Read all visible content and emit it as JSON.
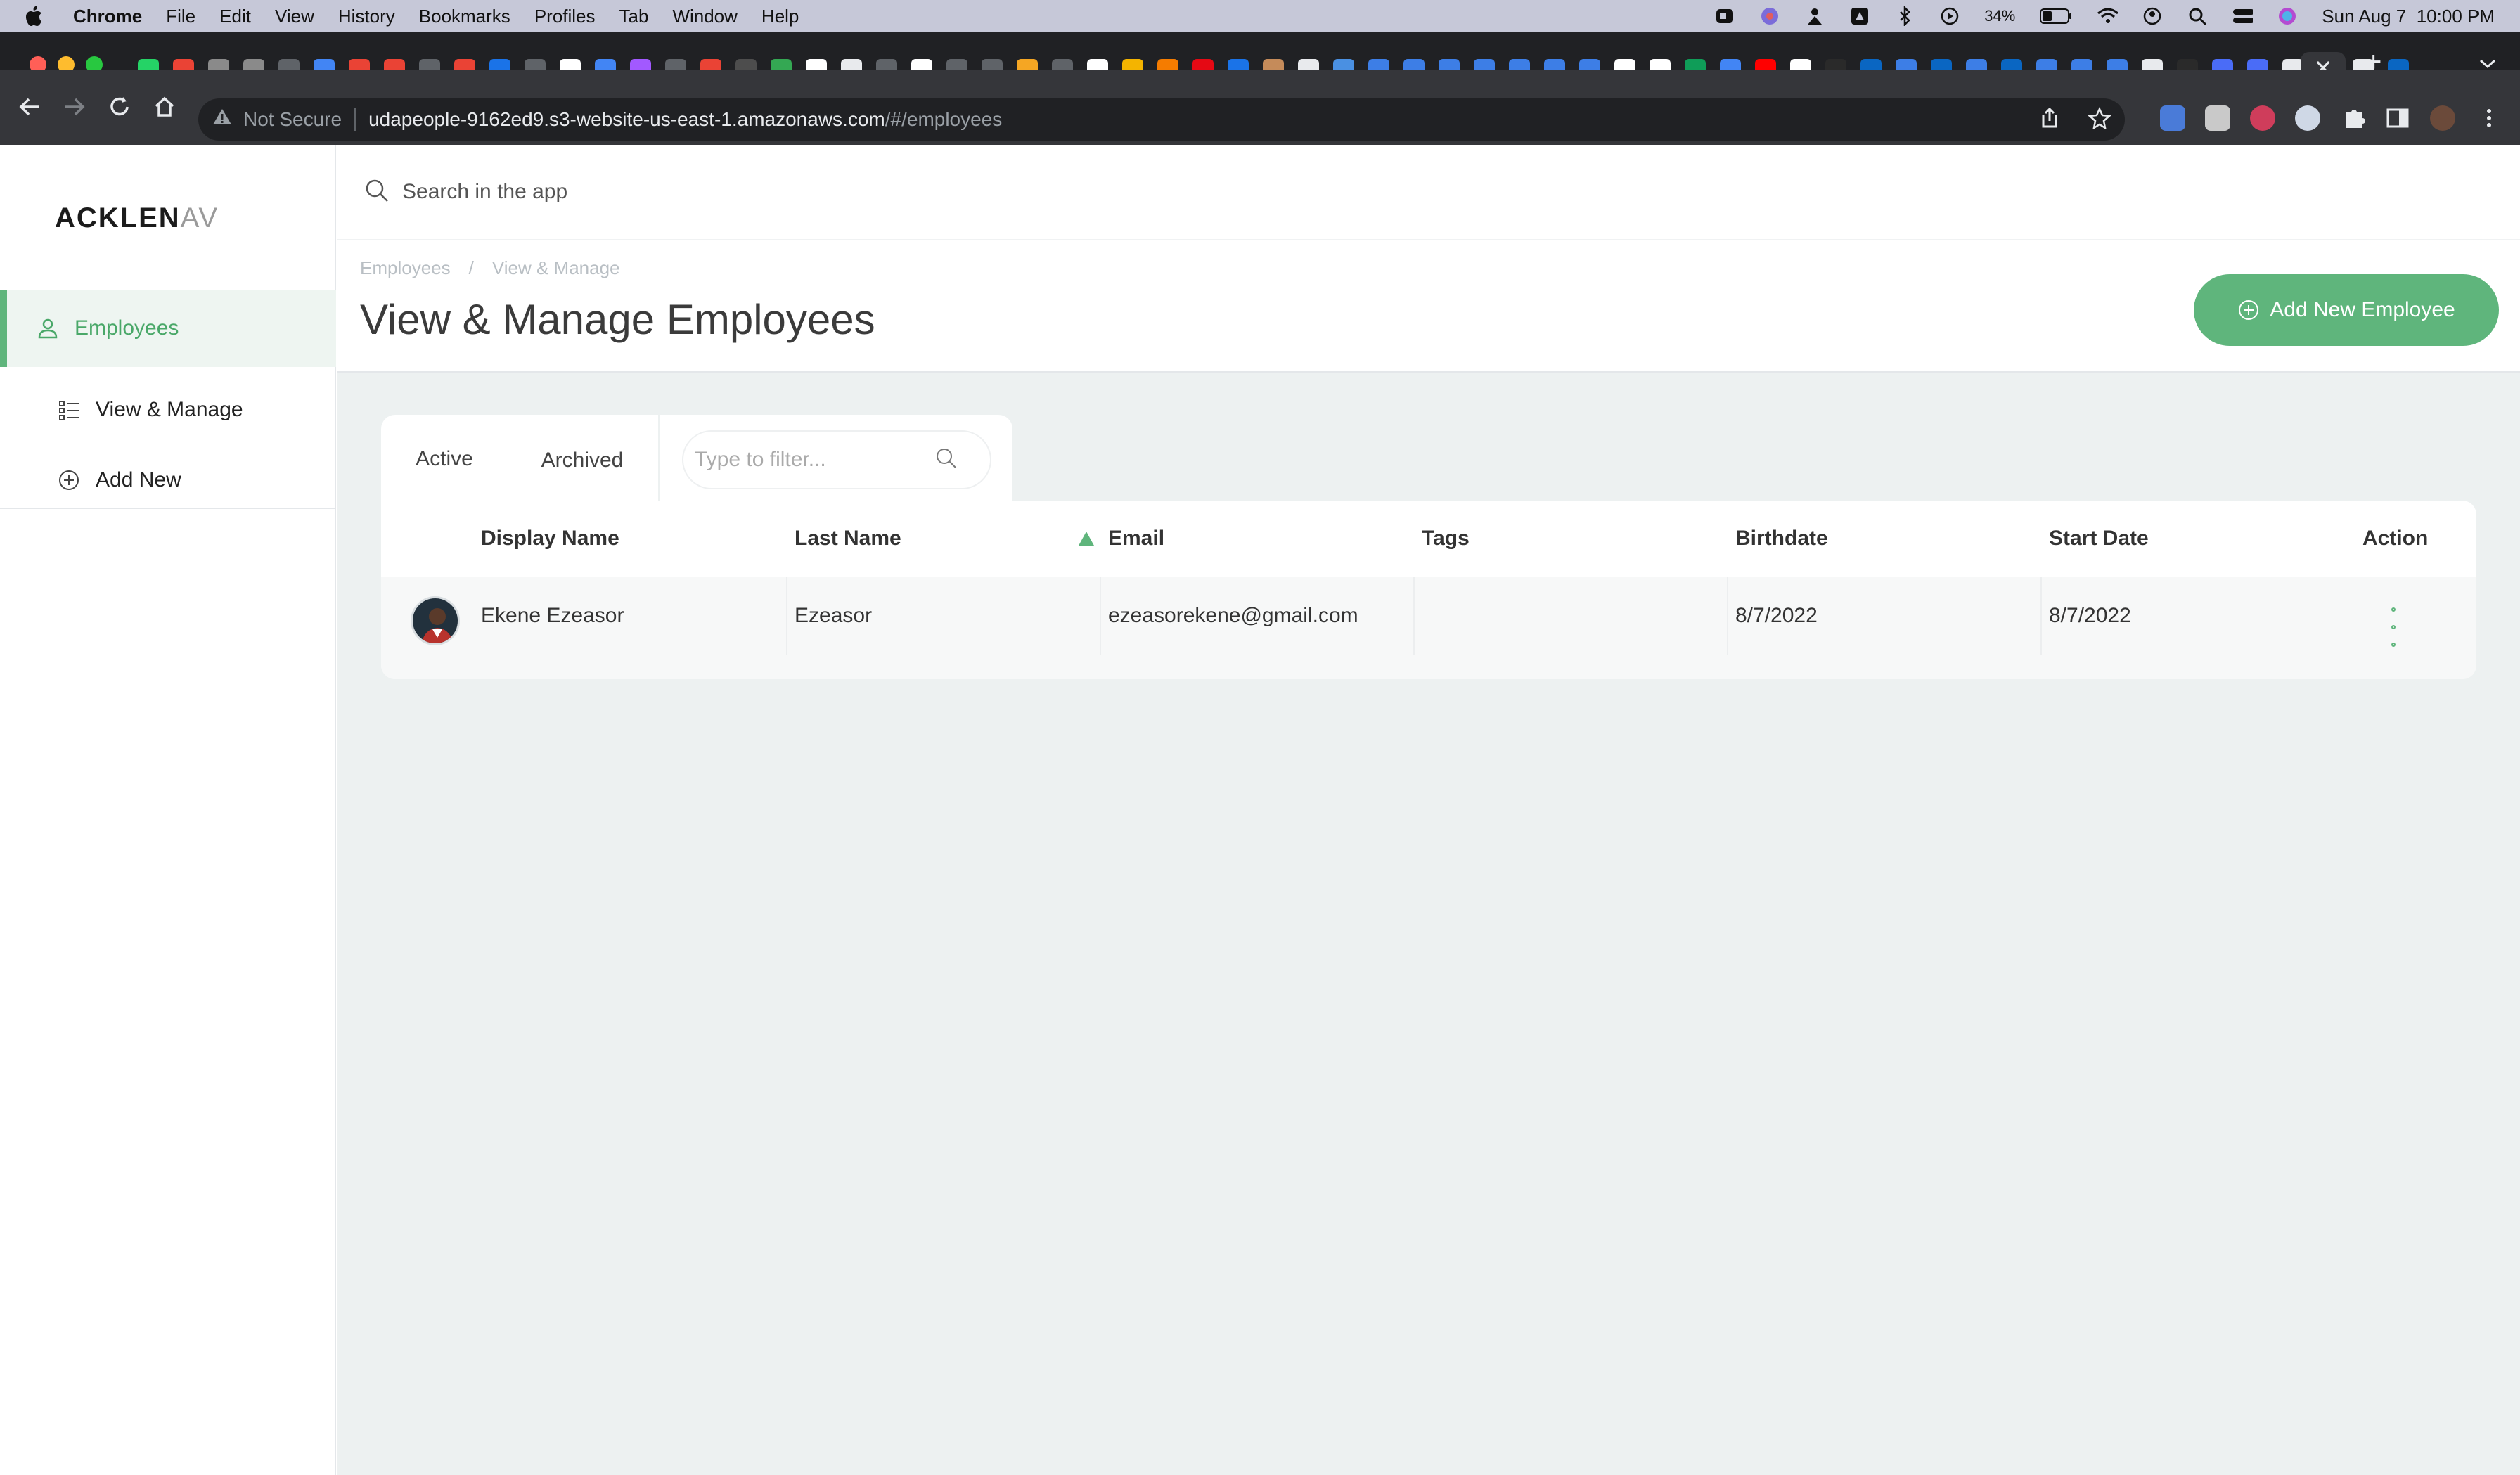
{
  "menubar": {
    "items": [
      "Chrome",
      "File",
      "Edit",
      "View",
      "History",
      "Bookmarks",
      "Profiles",
      "Tab",
      "Window",
      "Help"
    ],
    "battery": "34%",
    "clock": "Sun Aug 7  10:00 PM"
  },
  "browser": {
    "security_label": "Not Secure",
    "url_host": "udapeople-9162ed9.s3-website-us-east-1.amazonaws.com",
    "url_path": "/#/employees",
    "new_tab_label": "+",
    "close_tab_label": "✕"
  },
  "sidebar": {
    "logo_main": "ACKLEN",
    "logo_tail": "AV",
    "items": [
      {
        "label": "Employees",
        "icon": "user-icon"
      },
      {
        "label": "View & Manage",
        "icon": "list-icon"
      },
      {
        "label": "Add New",
        "icon": "plus-circle-icon"
      }
    ]
  },
  "search": {
    "placeholder": "Search in the app"
  },
  "header": {
    "breadcrumb": [
      "Employees",
      "/",
      "View & Manage"
    ],
    "title": "View & Manage Employees",
    "add_button": "Add New Employee"
  },
  "tabs": [
    {
      "label": "Active"
    },
    {
      "label": "Archived"
    }
  ],
  "filter": {
    "placeholder": "Type to filter..."
  },
  "table": {
    "columns": [
      "Display Name",
      "Last Name",
      "Email",
      "Tags",
      "Birthdate",
      "Start Date",
      "Action"
    ],
    "rows": [
      {
        "display_name": "Ekene Ezeasor",
        "last_name": "Ezeasor",
        "email": "ezeasorekene@gmail.com",
        "tags": "",
        "birthdate": "8/7/2022",
        "start_date": "8/7/2022"
      }
    ]
  },
  "colors": {
    "accent": "#5fb57c",
    "background": "#edf1f1"
  }
}
